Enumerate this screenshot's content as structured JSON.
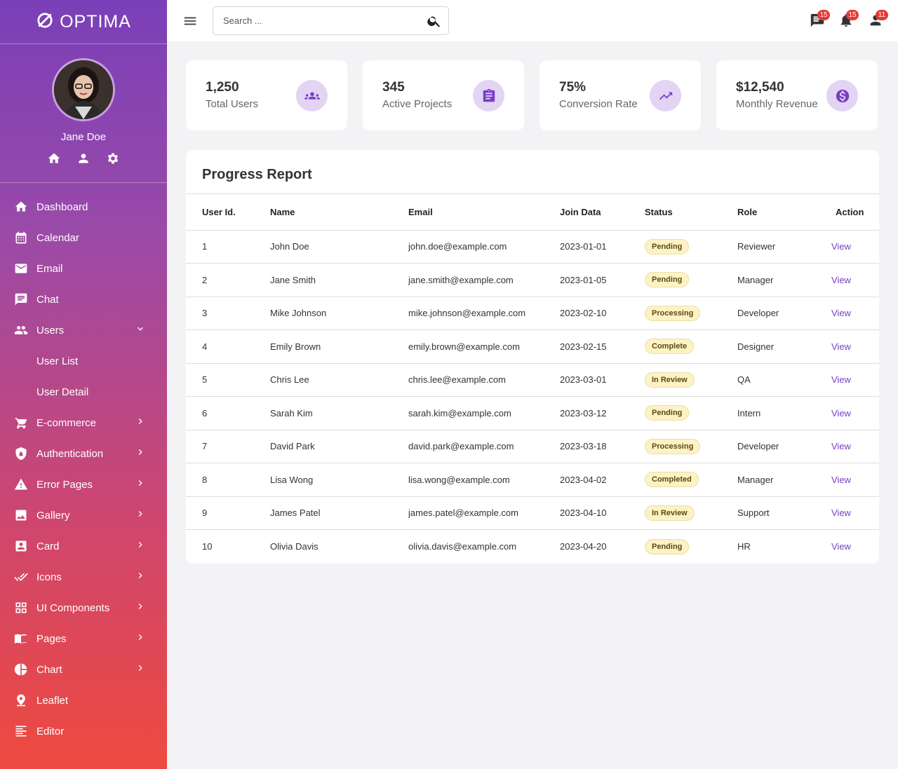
{
  "brand": {
    "name": "OPTIMA"
  },
  "profile": {
    "name": "Jane Doe"
  },
  "sidebar": {
    "items": [
      {
        "label": "Dashboard",
        "icon": "home-icon"
      },
      {
        "label": "Calendar",
        "icon": "calendar-icon"
      },
      {
        "label": "Email",
        "icon": "email-icon"
      },
      {
        "label": "Chat",
        "icon": "chat-icon"
      },
      {
        "label": "Users",
        "icon": "users-icon"
      },
      {
        "label": "User List"
      },
      {
        "label": "User Detail"
      },
      {
        "label": "E-commerce",
        "icon": "cart-icon"
      },
      {
        "label": "Authentication",
        "icon": "shield-icon"
      },
      {
        "label": "Error Pages",
        "icon": "warning-icon"
      },
      {
        "label": "Gallery",
        "icon": "image-icon"
      },
      {
        "label": "Card",
        "icon": "card-icon"
      },
      {
        "label": "Icons",
        "icon": "check-icon"
      },
      {
        "label": "UI Components",
        "icon": "grid-icon"
      },
      {
        "label": "Pages",
        "icon": "book-icon"
      },
      {
        "label": "Chart",
        "icon": "pie-icon"
      },
      {
        "label": "Leaflet",
        "icon": "pin-icon"
      },
      {
        "label": "Editor",
        "icon": "text-icon"
      }
    ]
  },
  "topbar": {
    "search_placeholder": "Search ...",
    "messages_count": "15",
    "notifications_count": "15",
    "users_count": "11"
  },
  "stats": [
    {
      "value": "1,250",
      "label": "Total Users",
      "icon": "group-icon"
    },
    {
      "value": "345",
      "label": "Active Projects",
      "icon": "clipboard-icon"
    },
    {
      "value": "75%",
      "label": "Conversion Rate",
      "icon": "trending-up-icon"
    },
    {
      "value": "$12,540",
      "label": "Monthly Revenue",
      "icon": "dollar-icon"
    }
  ],
  "report": {
    "title": "Progress Report",
    "columns": [
      "User Id.",
      "Name",
      "Email",
      "Join Data",
      "Status",
      "Role",
      "Action"
    ],
    "rows": [
      {
        "id": "1",
        "name": "John Doe",
        "email": "john.doe@example.com",
        "join": "2023-01-01",
        "status": "Pending",
        "role": "Reviewer",
        "action": "View"
      },
      {
        "id": "2",
        "name": "Jane Smith",
        "email": "jane.smith@example.com",
        "join": "2023-01-05",
        "status": "Pending",
        "role": "Manager",
        "action": "View"
      },
      {
        "id": "3",
        "name": "Mike Johnson",
        "email": "mike.johnson@example.com",
        "join": "2023-02-10",
        "status": "Processing",
        "role": "Developer",
        "action": "View"
      },
      {
        "id": "4",
        "name": "Emily Brown",
        "email": "emily.brown@example.com",
        "join": "2023-02-15",
        "status": "Complete",
        "role": "Designer",
        "action": "View"
      },
      {
        "id": "5",
        "name": "Chris Lee",
        "email": "chris.lee@example.com",
        "join": "2023-03-01",
        "status": "In Review",
        "role": "QA",
        "action": "View"
      },
      {
        "id": "6",
        "name": "Sarah Kim",
        "email": "sarah.kim@example.com",
        "join": "2023-03-12",
        "status": "Pending",
        "role": "Intern",
        "action": "View"
      },
      {
        "id": "7",
        "name": "David Park",
        "email": "david.park@example.com",
        "join": "2023-03-18",
        "status": "Processing",
        "role": "Developer",
        "action": "View"
      },
      {
        "id": "8",
        "name": "Lisa Wong",
        "email": "lisa.wong@example.com",
        "join": "2023-04-02",
        "status": "Completed",
        "role": "Manager",
        "action": "View"
      },
      {
        "id": "9",
        "name": "James Patel",
        "email": "james.patel@example.com",
        "join": "2023-04-10",
        "status": "In Review",
        "role": "Support",
        "action": "View"
      },
      {
        "id": "10",
        "name": "Olivia Davis",
        "email": "olivia.davis@example.com",
        "join": "2023-04-20",
        "status": "Pending",
        "role": "HR",
        "action": "View"
      }
    ]
  },
  "colors": {
    "accent": "#7a3fc4",
    "sidebar_top": "#7a3fb8",
    "sidebar_bottom": "#ee4a3f",
    "pill_bg": "#fdf2c4",
    "badge": "#e53935"
  }
}
